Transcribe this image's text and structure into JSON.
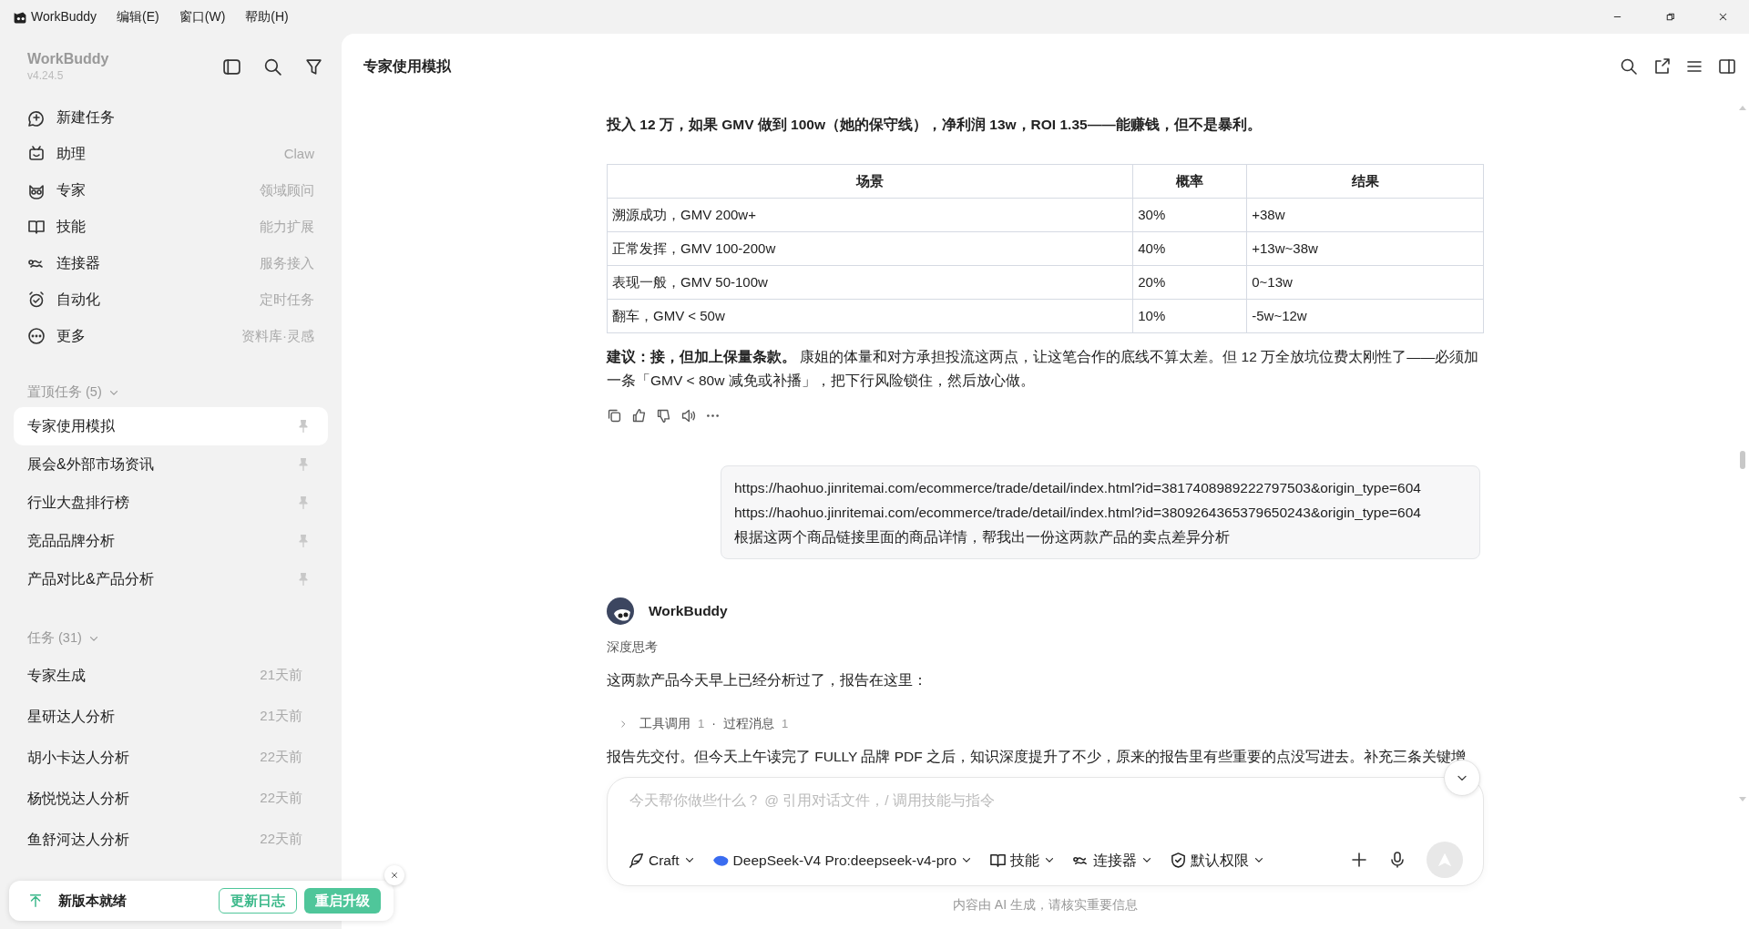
{
  "app": {
    "name": "WorkBuddy"
  },
  "menu": [
    "编辑(E)",
    "窗口(W)",
    "帮助(H)"
  ],
  "sidebar": {
    "title": "WorkBuddy",
    "version": "v4.24.5",
    "nav": [
      {
        "label": "新建任务"
      },
      {
        "label": "助理",
        "hint": "Claw"
      },
      {
        "label": "专家",
        "hint": "领域顾问"
      },
      {
        "label": "技能",
        "hint": "能力扩展"
      },
      {
        "label": "连接器",
        "hint": "服务接入"
      },
      {
        "label": "自动化",
        "hint": "定时任务"
      },
      {
        "label": "更多",
        "hint": "资料库·灵感"
      }
    ],
    "pinned": {
      "title": "置顶任务 (5)",
      "expanded": true,
      "items": [
        {
          "label": "专家使用模拟",
          "selected": true
        },
        {
          "label": "展会&外部市场资讯",
          "selected": false
        },
        {
          "label": "行业大盘排行榜",
          "selected": false
        },
        {
          "label": "竞品品牌分析",
          "selected": false
        },
        {
          "label": "产品对比&产品分析",
          "selected": false
        }
      ]
    },
    "tasks": {
      "title": "任务 (31)",
      "expanded": true,
      "items": [
        {
          "label": "专家生成",
          "time": "21天前"
        },
        {
          "label": "星研达人分析",
          "time": "21天前"
        },
        {
          "label": "胡小卡达人分析",
          "time": "22天前"
        },
        {
          "label": "杨悦悦达人分析",
          "time": "22天前"
        },
        {
          "label": "鱼舒河达人分析",
          "time": "22天前"
        }
      ]
    },
    "update": {
      "text": "新版本就绪",
      "buttons": [
        "更新日志",
        "重启升级"
      ]
    }
  },
  "chat": {
    "title": "专家使用模拟",
    "summary": "投入 12 万，如果 GMV 做到 100w（她的保守线），净利润 13w，ROI 1.35——能赚钱，但不是暴利。",
    "table": {
      "columns": [
        "场景",
        "概率",
        "结果"
      ],
      "rows": [
        [
          "溯源成功，GMV 200w+",
          "30%",
          "+38w"
        ],
        [
          "正常发挥，GMV 100-200w",
          "40%",
          "+13w~38w"
        ],
        [
          "表现一般，GMV 50-100w",
          "20%",
          "0~13w"
        ],
        [
          "翻车，GMV < 50w",
          "10%",
          "-5w~12w"
        ]
      ]
    },
    "advice": "**建议：接，但加上保量条款。** 康姐的体量和对方承担投流这两点，让这笔合作的底线不算太差。但 12 万全放坑位费太刚性了——必须加一条「GMV < 80w 减免或补播」，把下行风险锁住，然后放心做。",
    "user_message": [
      "https://haohuo.jinritemai.com/ecommerce/trade/detail/index.html?id=3817408989222797503&origin_type=604",
      "https://haohuo.jinritemai.com/ecommerce/trade/detail/index.html?id=3809264365379650243&origin_type=604",
      "根据这两个商品链接里面的商品详情，帮我出一份这两款产品的卖点差异分析"
    ],
    "reply": {
      "author": "WorkBuddy",
      "thinking": "深度思考",
      "intro": "这两款产品今天早上已经分析过了，报告在这里：",
      "process": {
        "expanded": false,
        "separator": "·",
        "items": [
          {
            "label": "工具调用",
            "count": "1"
          },
          {
            "label": "过程消息",
            "count": "1"
          }
        ]
      },
      "body": "报告先交付。但今天上午读完了 FULLY 品牌 PDF 之后，知识深度提升了不少，原来的报告里有些重要的点没写进去。补充三条关键增"
    }
  },
  "composer": {
    "placeholder": "今天帮你做些什么？ @ 引用对话文件，/ 调用技能与指令",
    "tools": [
      "Craft",
      "DeepSeek-V4 Pro:deepseek-v4-pro",
      "技能",
      "连接器",
      "默认权限"
    ]
  },
  "disclaimer": "内容由 AI 生成，请核实重要信息"
}
